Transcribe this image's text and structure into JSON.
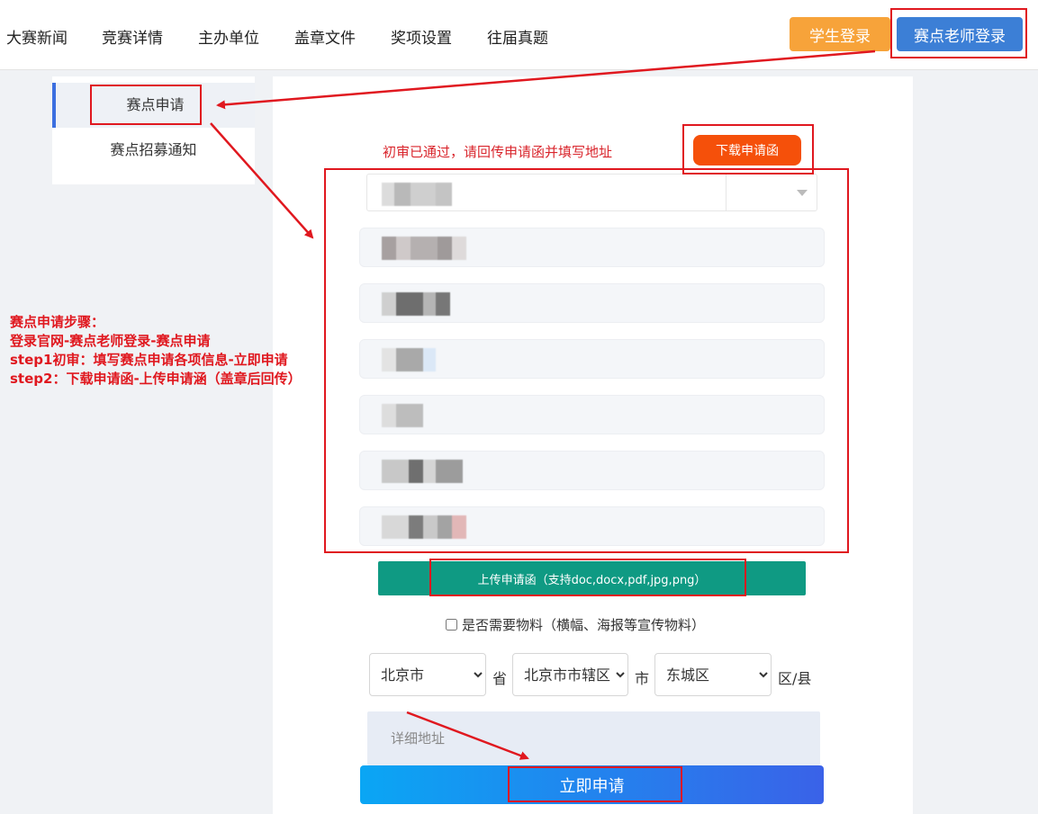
{
  "nav": {
    "items": [
      "大赛新闻",
      "竞赛详情",
      "主办单位",
      "盖章文件",
      "奖项设置",
      "往届真题"
    ],
    "student_login": "学生登录",
    "teacher_login": "赛点老师登录"
  },
  "sidebar": {
    "items": [
      {
        "label": "赛点申请",
        "active": true
      },
      {
        "label": "赛点招募通知",
        "active": false
      }
    ]
  },
  "form": {
    "notice": "初审已通过，请回传申请函并填写地址",
    "download_label": "下载申请函",
    "upload_label": "上传申请函（支持doc,docx,pdf,jpg,png）",
    "materials_label": "是否需要物料（横幅、海报等宣传物料）",
    "materials_checked": false,
    "province": {
      "value": "北京市",
      "suffix": "省"
    },
    "city": {
      "value": "北京市市辖区",
      "suffix": "市"
    },
    "district": {
      "value": "东城区",
      "suffix": "区/县"
    },
    "address_placeholder": "详细地址",
    "submit_label": "立即申请"
  },
  "annotation": {
    "lines": [
      "赛点申请步骤：",
      "登录官网-赛点老师登录-赛点申请",
      "step1初审：填写赛点申请各项信息-立即申请",
      "step2：下载申请函-上传申请涵（盖章后回传）"
    ],
    "color": "#e0181f"
  },
  "colors": {
    "student_button": "#f7a33a",
    "teacher_button": "#3c7fd6",
    "download_button": "#f5500a",
    "upload_button": "#0f9a83",
    "submit_gradient": [
      "#0aa6f4",
      "#3a62e8"
    ]
  }
}
